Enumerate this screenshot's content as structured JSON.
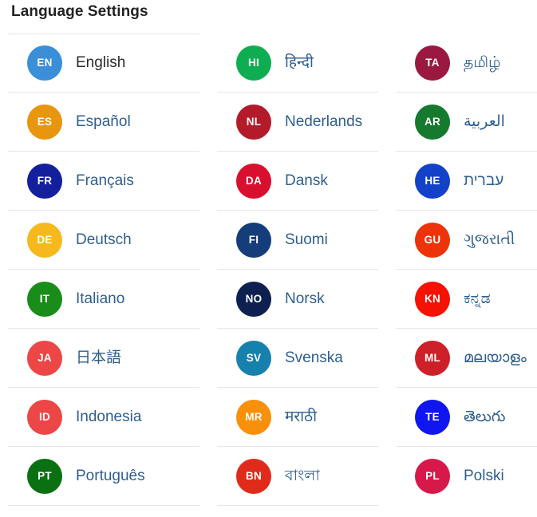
{
  "page": {
    "title": "Language Settings",
    "link_color": "#2e5e8e",
    "current_color": "#2b2b2b",
    "divider_color": "#e6e6e6",
    "background": "#ffffff"
  },
  "columns": [
    {
      "name": "column-1",
      "items": [
        {
          "code": "EN",
          "label": "English",
          "color": "#3b8ed8",
          "current": true
        },
        {
          "code": "ES",
          "label": "Español",
          "color": "#e8960e",
          "current": false
        },
        {
          "code": "FR",
          "label": "Français",
          "color": "#141f9e",
          "current": false
        },
        {
          "code": "DE",
          "label": "Deutsch",
          "color": "#f5b91e",
          "current": false
        },
        {
          "code": "IT",
          "label": "Italiano",
          "color": "#1a8c1a",
          "current": false
        },
        {
          "code": "JA",
          "label": "日本語",
          "color": "#ec4646",
          "current": false
        },
        {
          "code": "ID",
          "label": "Indonesia",
          "color": "#ec4646",
          "current": false
        },
        {
          "code": "PT",
          "label": "Português",
          "color": "#0b7012",
          "current": false
        }
      ]
    },
    {
      "name": "column-2",
      "items": [
        {
          "code": "HI",
          "label": "हिन्दी",
          "color": "#0ead51",
          "current": false
        },
        {
          "code": "NL",
          "label": "Nederlands",
          "color": "#b31b2b",
          "current": false
        },
        {
          "code": "DA",
          "label": "Dansk",
          "color": "#d80f2e",
          "current": false
        },
        {
          "code": "FI",
          "label": "Suomi",
          "color": "#153d7a",
          "current": false
        },
        {
          "code": "NO",
          "label": "Norsk",
          "color": "#0d2050",
          "current": false
        },
        {
          "code": "SV",
          "label": "Svenska",
          "color": "#1781ad",
          "current": false
        },
        {
          "code": "MR",
          "label": "मराठी",
          "color": "#f99009",
          "current": false
        },
        {
          "code": "BN",
          "label": "বাংলা",
          "color": "#e02b1a",
          "current": false
        }
      ]
    },
    {
      "name": "column-3",
      "items": [
        {
          "code": "TA",
          "label": "தமிழ்",
          "color": "#9b1840",
          "current": false
        },
        {
          "code": "AR",
          "label": "العربية",
          "color": "#15792e",
          "current": false
        },
        {
          "code": "HE",
          "label": "עברית",
          "color": "#1341c8",
          "current": false
        },
        {
          "code": "GU",
          "label": "ગુજરાતી",
          "color": "#ed3309",
          "current": false
        },
        {
          "code": "KN",
          "label": "ಕನ್ನಡ",
          "color": "#f61103",
          "current": false
        },
        {
          "code": "ML",
          "label": "മലയാളം",
          "color": "#ce2029",
          "current": false
        },
        {
          "code": "TE",
          "label": "తెలుగు",
          "color": "#1016f0",
          "current": false
        },
        {
          "code": "PL",
          "label": "Polski",
          "color": "#d6194a",
          "current": false
        }
      ]
    }
  ]
}
